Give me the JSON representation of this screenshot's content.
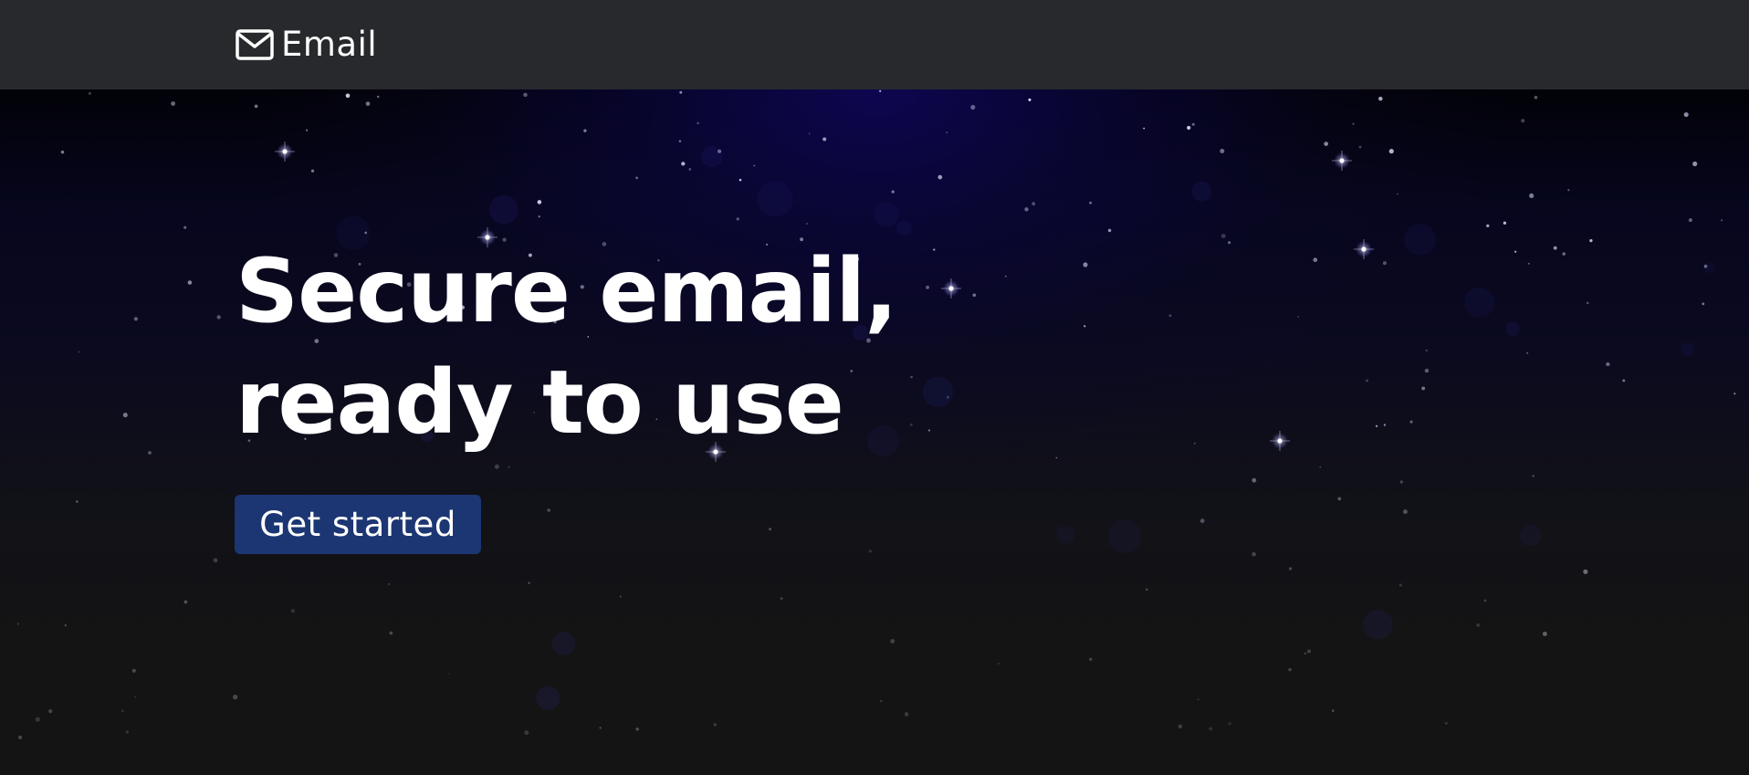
{
  "header": {
    "brand_label": "Email",
    "brand_icon": "mail-icon"
  },
  "hero": {
    "headline_line1": "Secure email,",
    "headline_line2": "ready to use",
    "cta_label": "Get started"
  },
  "colors": {
    "header_bg": "#28292d",
    "page_bg": "#141414",
    "cta_bg": "#1c3673",
    "text": "#ffffff",
    "glow": "#0e0654"
  }
}
